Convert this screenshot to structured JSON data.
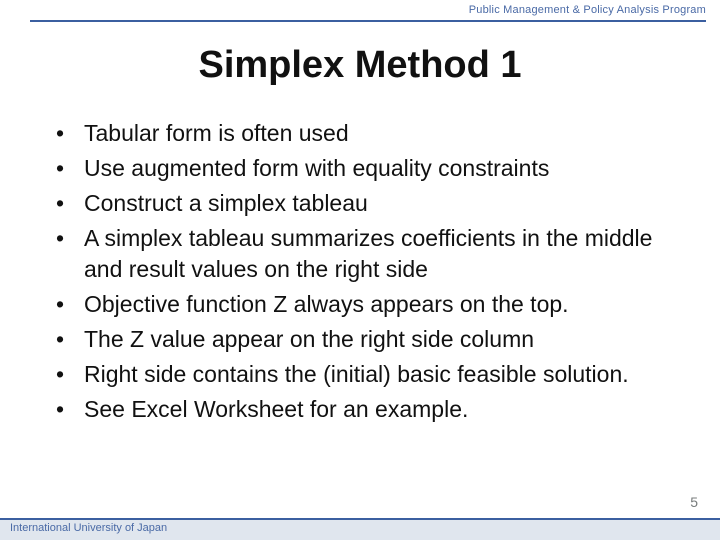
{
  "header": {
    "program_label": "Public Management & Policy Analysis Program"
  },
  "title": "Simplex Method 1",
  "bullets": [
    "Tabular form is often used",
    "Use augmented form with equality constraints",
    "Construct a simplex tableau",
    "A simplex tableau summarizes coefficients in the middle and result values  on the right side",
    "Objective function Z always appears on the top.",
    "The Z value appear on the right side column",
    "Right side contains the (initial) basic feasible solution.",
    "See Excel Worksheet for an example."
  ],
  "footer": {
    "university": "International University of Japan",
    "page_number": "5"
  }
}
